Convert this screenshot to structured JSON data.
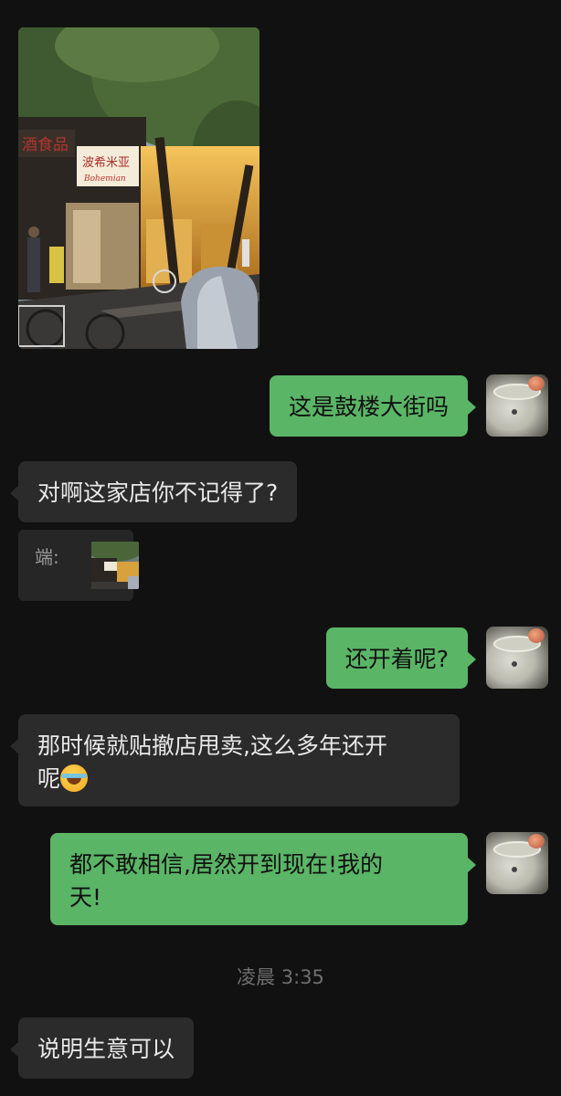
{
  "messages": [
    {
      "side": "left",
      "type": "image",
      "description": "street photo"
    },
    {
      "side": "right",
      "text": "这是鼓楼大街吗"
    },
    {
      "side": "left",
      "text": "对啊这家店你不记得了?"
    },
    {
      "side": "left",
      "type": "quote",
      "label": "端:"
    },
    {
      "side": "right",
      "text": "还开着呢?"
    },
    {
      "side": "left",
      "text_line1": "那时候就贴撤店甩卖,这么多年还开",
      "text_line2": "呢"
    },
    {
      "side": "right",
      "text_line1": "都不敢相信,居然开到现在!我的",
      "text_line2": "天!"
    },
    {
      "type": "timestamp",
      "text": "凌晨 3:35"
    },
    {
      "side": "left",
      "text": "说明生意可以"
    }
  ],
  "colors": {
    "background": "#111111",
    "outgoing_bubble": "#5ab566",
    "incoming_bubble": "#2b2b2b"
  },
  "icons": {
    "emoji": "tears-of-joy-emoji",
    "avatar": "user-avatar"
  },
  "photo": {
    "shop_sign": "波希米亚",
    "shop_sign_sub": "Bohemian"
  }
}
